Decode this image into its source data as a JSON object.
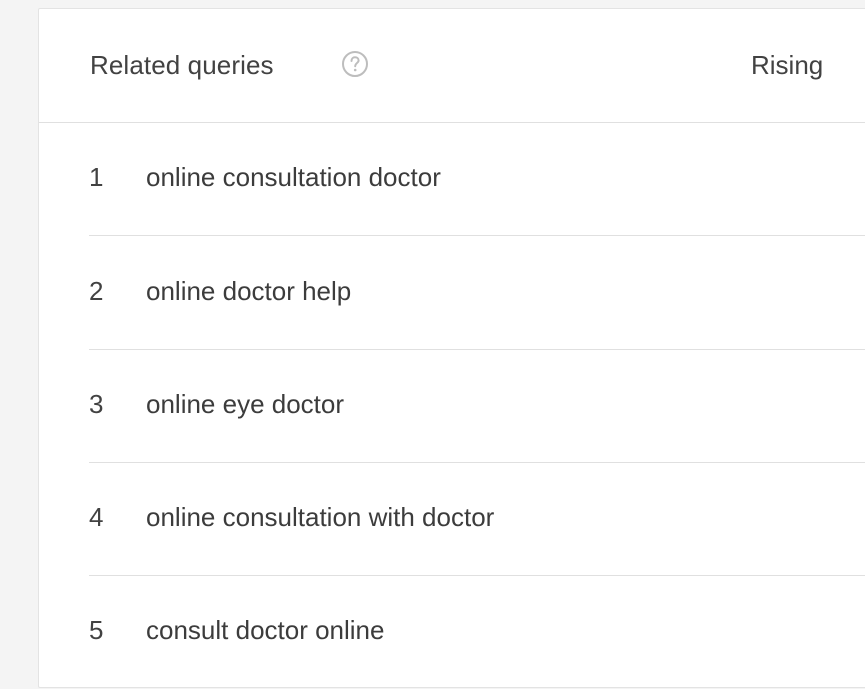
{
  "widget": {
    "title": "Related queries",
    "filter_label": "Rising",
    "help_icon": "help-circle-icon"
  },
  "queries": [
    {
      "rank": "1",
      "text": "online consultation doctor"
    },
    {
      "rank": "2",
      "text": "online doctor help"
    },
    {
      "rank": "3",
      "text": "online eye doctor"
    },
    {
      "rank": "4",
      "text": "online consultation with doctor"
    },
    {
      "rank": "5",
      "text": "consult doctor online"
    }
  ],
  "colors": {
    "text": "#424242",
    "divider": "#e0e0e0",
    "icon": "#bdbdbd",
    "background": "#f4f4f4",
    "card": "#ffffff"
  }
}
